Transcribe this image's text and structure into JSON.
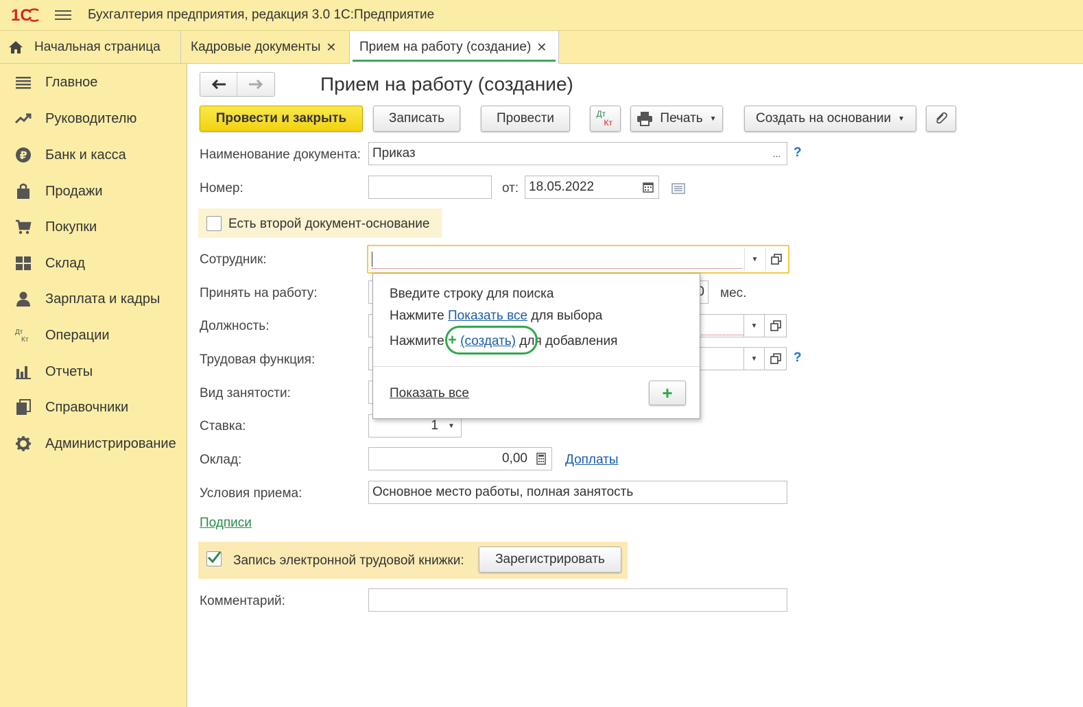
{
  "app": {
    "logo": "1С",
    "title": "Бухгалтерия предприятия, редакция 3.0 1С:Предприятие"
  },
  "tabs": [
    {
      "label": "Начальная страница",
      "closable": false
    },
    {
      "label": "Кадровые документы",
      "closable": true
    },
    {
      "label": "Прием на работу (создание)",
      "closable": true,
      "active": true
    }
  ],
  "close_glyph": "✕",
  "sidebar": {
    "items": [
      {
        "label": "Главное",
        "icon": "list-icon"
      },
      {
        "label": "Руководителю",
        "icon": "trend-icon"
      },
      {
        "label": "Банк и касса",
        "icon": "ruble-icon"
      },
      {
        "label": "Продажи",
        "icon": "bag-icon"
      },
      {
        "label": "Покупки",
        "icon": "cart-icon"
      },
      {
        "label": "Склад",
        "icon": "warehouse-icon"
      },
      {
        "label": "Зарплата и кадры",
        "icon": "person-icon"
      },
      {
        "label": "Операции",
        "icon": "dt-kt-icon"
      },
      {
        "label": "Отчеты",
        "icon": "bar-chart-icon"
      },
      {
        "label": "Справочники",
        "icon": "books-icon"
      },
      {
        "label": "Администрирование",
        "icon": "gear-icon"
      }
    ]
  },
  "document": {
    "title": "Прием на работу (создание)",
    "toolbar": {
      "post_close": "Провести и закрыть",
      "save": "Записать",
      "post": "Провести",
      "dtkt_top": "Дт",
      "dtkt_bottom": "Кт",
      "print": "Печать",
      "create_based": "Создать на основании"
    },
    "fields": {
      "doc_name_label": "Наименование документа:",
      "doc_name_value": "Приказ",
      "number_label": "Номер:",
      "number_value": "",
      "date_label": "от:",
      "date_value": "18.05.2022",
      "second_doc_label": "Есть второй документ-основание",
      "employee_label": "Сотрудник:",
      "employee_value": "",
      "hire_label": "Принять на работу:",
      "hire_value_tail": "0",
      "months_label": "мес.",
      "position_label": "Должность:",
      "function_label": "Трудовая функция:",
      "employment_type_label": "Вид занятости:",
      "rate_label": "Ставка:",
      "rate_value": "1",
      "salary_label": "Оклад:",
      "salary_value": "0,00",
      "allowances_link": "Доплаты",
      "conditions_label": "Условия приема:",
      "conditions_value": "Основное место работы, полная занятость",
      "signatures_link": "Подписи",
      "electronic_book_label": "Запись электронной трудовой книжки:",
      "electronic_book_checked": true,
      "register_button": "Зарегистрировать",
      "comment_label": "Комментарий:",
      "comment_value": ""
    },
    "help_mark": "?",
    "choose_glyph": "...",
    "popup": {
      "line1": "Введите строку для поиска",
      "line2_pre": "Нажмите",
      "line2_link": "Показать все",
      "line2_post": "для выбора",
      "line3_pre": "Нажмите",
      "line3_plus": "+",
      "line3_link": "(создать)",
      "line3_post": "для добавления",
      "show_all": "Показать все"
    }
  },
  "colors": {
    "panel": "#fbeda6",
    "primary_button": "#f3d210",
    "link": "#1a5cad",
    "accent_green": "#2fa84f"
  }
}
